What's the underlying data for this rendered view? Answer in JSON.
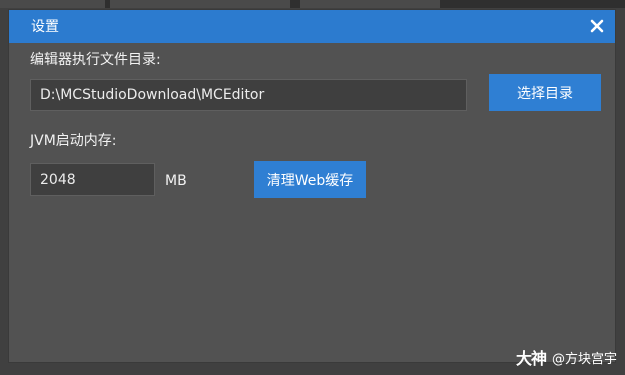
{
  "dialog": {
    "title": "设置",
    "close_icon": "close-icon"
  },
  "editor_path": {
    "label": "编辑器执行文件目录:",
    "value": "D:\\MCStudioDownload\\MCEditor",
    "browse_label": "选择目录"
  },
  "jvm": {
    "label": "JVM启动内存:",
    "value": "2048",
    "unit": "MB",
    "clear_cache_label": "清理Web缓存"
  },
  "watermark": {
    "logo": "大神",
    "text": "@方块宫宇"
  },
  "colors": {
    "accent": "#2c7bcf",
    "dialog_bg": "#525252",
    "field_bg": "#3f3f3f"
  }
}
